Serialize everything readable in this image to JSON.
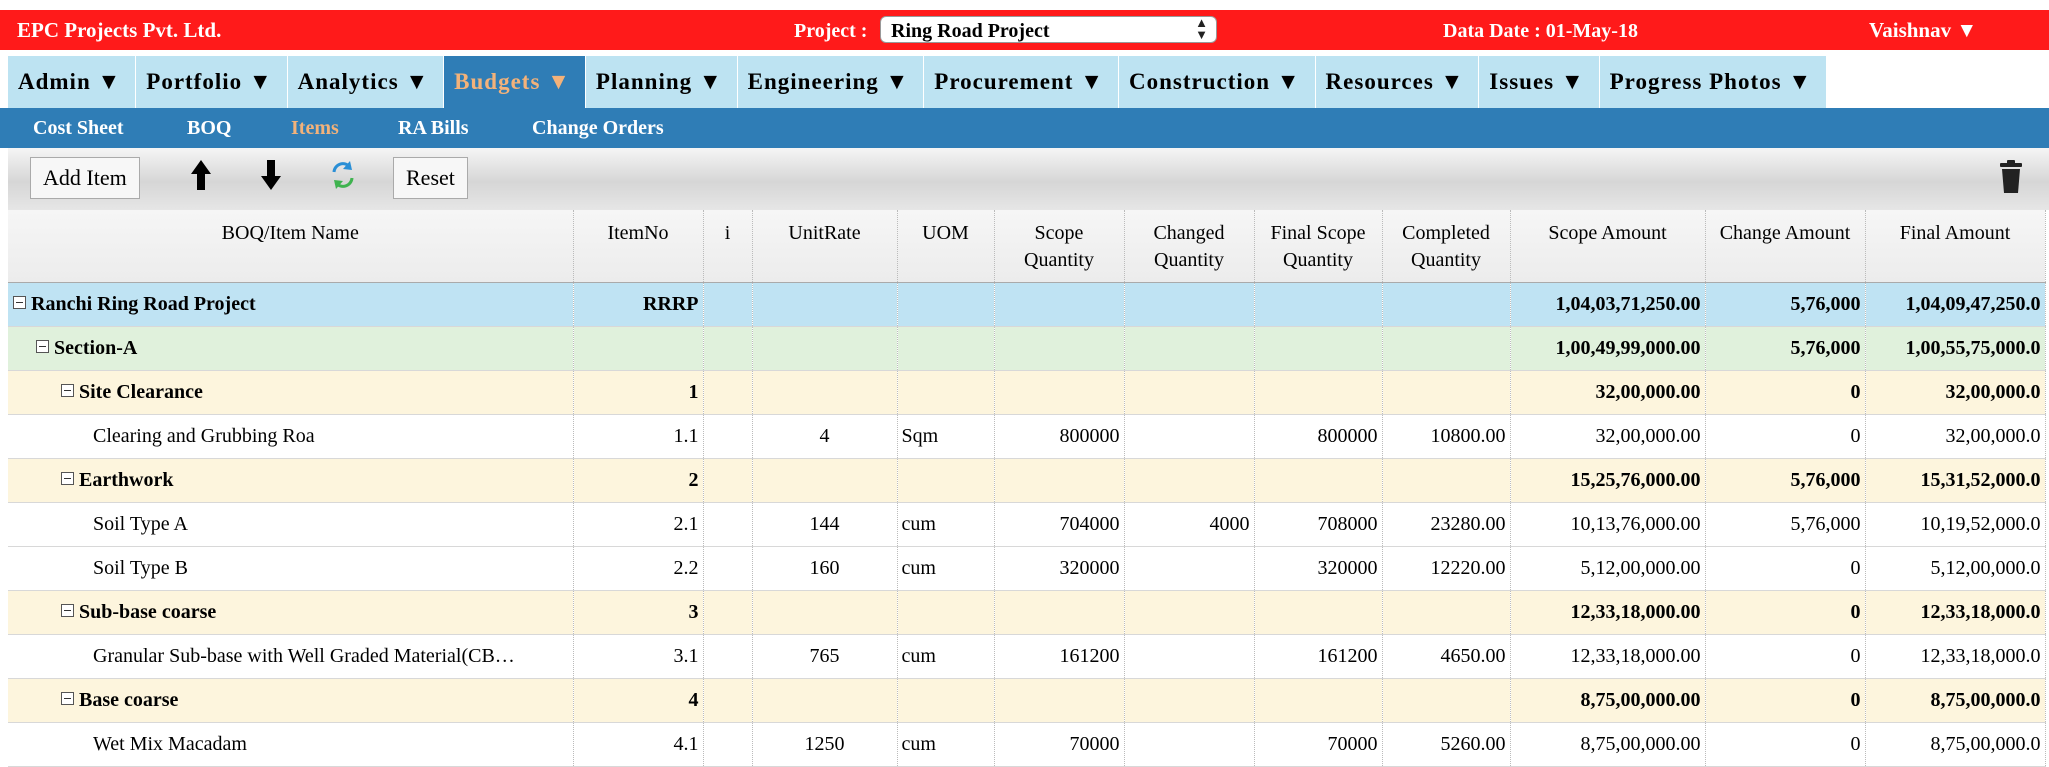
{
  "header": {
    "company": "EPC Projects Pvt. Ltd.",
    "project_label": "Project :",
    "project_value": "Ring Road Project",
    "data_date": "Data Date : 01-May-18",
    "user": "Vaishnav ▼"
  },
  "main_nav": [
    {
      "label": "Admin ▼",
      "active": false
    },
    {
      "label": "Portfolio ▼",
      "active": false
    },
    {
      "label": "Analytics ▼",
      "active": false
    },
    {
      "label": "Budgets ▼",
      "active": true
    },
    {
      "label": "Planning ▼",
      "active": false
    },
    {
      "label": "Engineering ▼",
      "active": false
    },
    {
      "label": "Procurement ▼",
      "active": false
    },
    {
      "label": "Construction ▼",
      "active": false
    },
    {
      "label": "Resources ▼",
      "active": false
    },
    {
      "label": "Issues ▼",
      "active": false
    },
    {
      "label": "Progress Photos ▼",
      "active": false
    }
  ],
  "sub_nav": [
    {
      "label": "Cost Sheet",
      "active": false
    },
    {
      "label": "BOQ",
      "active": false
    },
    {
      "label": "Items",
      "active": true
    },
    {
      "label": "RA Bills",
      "active": false
    },
    {
      "label": "Change Orders",
      "active": false
    }
  ],
  "toolbar": {
    "add_item": "Add Item",
    "move_up_icon": "arrow-up-icon",
    "move_down_icon": "arrow-down-icon",
    "refresh_icon": "refresh-icon",
    "reset": "Reset",
    "delete_icon": "trash-icon"
  },
  "colors": {
    "topbar": "#ff1a1a",
    "nav_active": "#2f7db6",
    "nav_active_text": "#f3b27a",
    "row_project": "#bfe3f3",
    "row_section": "#e0f1dc",
    "row_group": "#fdf5dd"
  },
  "table": {
    "columns": [
      {
        "top": "BOQ/Item Name",
        "bottom": ""
      },
      {
        "top": "ItemNo",
        "bottom": ""
      },
      {
        "top": "i",
        "bottom": ""
      },
      {
        "top": "UnitRate",
        "bottom": ""
      },
      {
        "top": "UOM",
        "bottom": ""
      },
      {
        "top": "Scope",
        "bottom": "Quantity"
      },
      {
        "top": "Changed",
        "bottom": "Quantity"
      },
      {
        "top": "Final Scope",
        "bottom": "Quantity"
      },
      {
        "top": "Completed",
        "bottom": "Quantity"
      },
      {
        "top": "Scope Amount",
        "bottom": ""
      },
      {
        "top": "Change Amount",
        "bottom": ""
      },
      {
        "top": "Final Amount",
        "bottom": ""
      }
    ],
    "rows": [
      {
        "level": 0,
        "toggle": true,
        "name": "Ranchi Ring Road Project",
        "item_no": "RRRP",
        "i": "",
        "unit_rate": "",
        "uom": "",
        "scope_qty": "",
        "changed_qty": "",
        "final_scope_qty": "",
        "completed_qty": "",
        "scope_amount": "1,04,03,71,250.00",
        "change_amount": "5,76,000",
        "final_amount": "1,04,09,47,250.0"
      },
      {
        "level": 1,
        "toggle": true,
        "name": "Section-A",
        "item_no": "",
        "i": "",
        "unit_rate": "",
        "uom": "",
        "scope_qty": "",
        "changed_qty": "",
        "final_scope_qty": "",
        "completed_qty": "",
        "scope_amount": "1,00,49,99,000.00",
        "change_amount": "5,76,000",
        "final_amount": "1,00,55,75,000.0"
      },
      {
        "level": 2,
        "toggle": true,
        "name": "Site Clearance",
        "item_no": "1",
        "i": "",
        "unit_rate": "",
        "uom": "",
        "scope_qty": "",
        "changed_qty": "",
        "final_scope_qty": "",
        "completed_qty": "",
        "scope_amount": "32,00,000.00",
        "change_amount": "0",
        "final_amount": "32,00,000.0"
      },
      {
        "level": 3,
        "toggle": false,
        "name": "Clearing and Grubbing Roa",
        "item_no": "1.1",
        "i": "",
        "unit_rate": "4",
        "uom": "Sqm",
        "scope_qty": "800000",
        "changed_qty": "",
        "final_scope_qty": "800000",
        "completed_qty": "10800.00",
        "scope_amount": "32,00,000.00",
        "change_amount": "0",
        "final_amount": "32,00,000.0"
      },
      {
        "level": 2,
        "toggle": true,
        "name": "Earthwork",
        "item_no": "2",
        "i": "",
        "unit_rate": "",
        "uom": "",
        "scope_qty": "",
        "changed_qty": "",
        "final_scope_qty": "",
        "completed_qty": "",
        "scope_amount": "15,25,76,000.00",
        "change_amount": "5,76,000",
        "final_amount": "15,31,52,000.0"
      },
      {
        "level": 3,
        "toggle": false,
        "name": "Soil Type A",
        "item_no": "2.1",
        "i": "",
        "unit_rate": "144",
        "uom": "cum",
        "scope_qty": "704000",
        "changed_qty": "4000",
        "final_scope_qty": "708000",
        "completed_qty": "23280.00",
        "scope_amount": "10,13,76,000.00",
        "change_amount": "5,76,000",
        "final_amount": "10,19,52,000.0"
      },
      {
        "level": 3,
        "toggle": false,
        "name": "Soil Type B",
        "item_no": "2.2",
        "i": "",
        "unit_rate": "160",
        "uom": "cum",
        "scope_qty": "320000",
        "changed_qty": "",
        "final_scope_qty": "320000",
        "completed_qty": "12220.00",
        "scope_amount": "5,12,00,000.00",
        "change_amount": "0",
        "final_amount": "5,12,00,000.0"
      },
      {
        "level": 2,
        "toggle": true,
        "name": "Sub-base coarse",
        "item_no": "3",
        "i": "",
        "unit_rate": "",
        "uom": "",
        "scope_qty": "",
        "changed_qty": "",
        "final_scope_qty": "",
        "completed_qty": "",
        "scope_amount": "12,33,18,000.00",
        "change_amount": "0",
        "final_amount": "12,33,18,000.0"
      },
      {
        "level": 3,
        "toggle": false,
        "name": "Granular Sub-base with Well Graded Material(CB…",
        "item_no": "3.1",
        "i": "",
        "unit_rate": "765",
        "uom": "cum",
        "scope_qty": "161200",
        "changed_qty": "",
        "final_scope_qty": "161200",
        "completed_qty": "4650.00",
        "scope_amount": "12,33,18,000.00",
        "change_amount": "0",
        "final_amount": "12,33,18,000.0"
      },
      {
        "level": 2,
        "toggle": true,
        "name": "Base coarse",
        "item_no": "4",
        "i": "",
        "unit_rate": "",
        "uom": "",
        "scope_qty": "",
        "changed_qty": "",
        "final_scope_qty": "",
        "completed_qty": "",
        "scope_amount": "8,75,00,000.00",
        "change_amount": "0",
        "final_amount": "8,75,00,000.0"
      },
      {
        "level": 3,
        "toggle": false,
        "name": "Wet Mix Macadam",
        "item_no": "4.1",
        "i": "",
        "unit_rate": "1250",
        "uom": "cum",
        "scope_qty": "70000",
        "changed_qty": "",
        "final_scope_qty": "70000",
        "completed_qty": "5260.00",
        "scope_amount": "8,75,00,000.00",
        "change_amount": "0",
        "final_amount": "8,75,00,000.0"
      }
    ]
  }
}
